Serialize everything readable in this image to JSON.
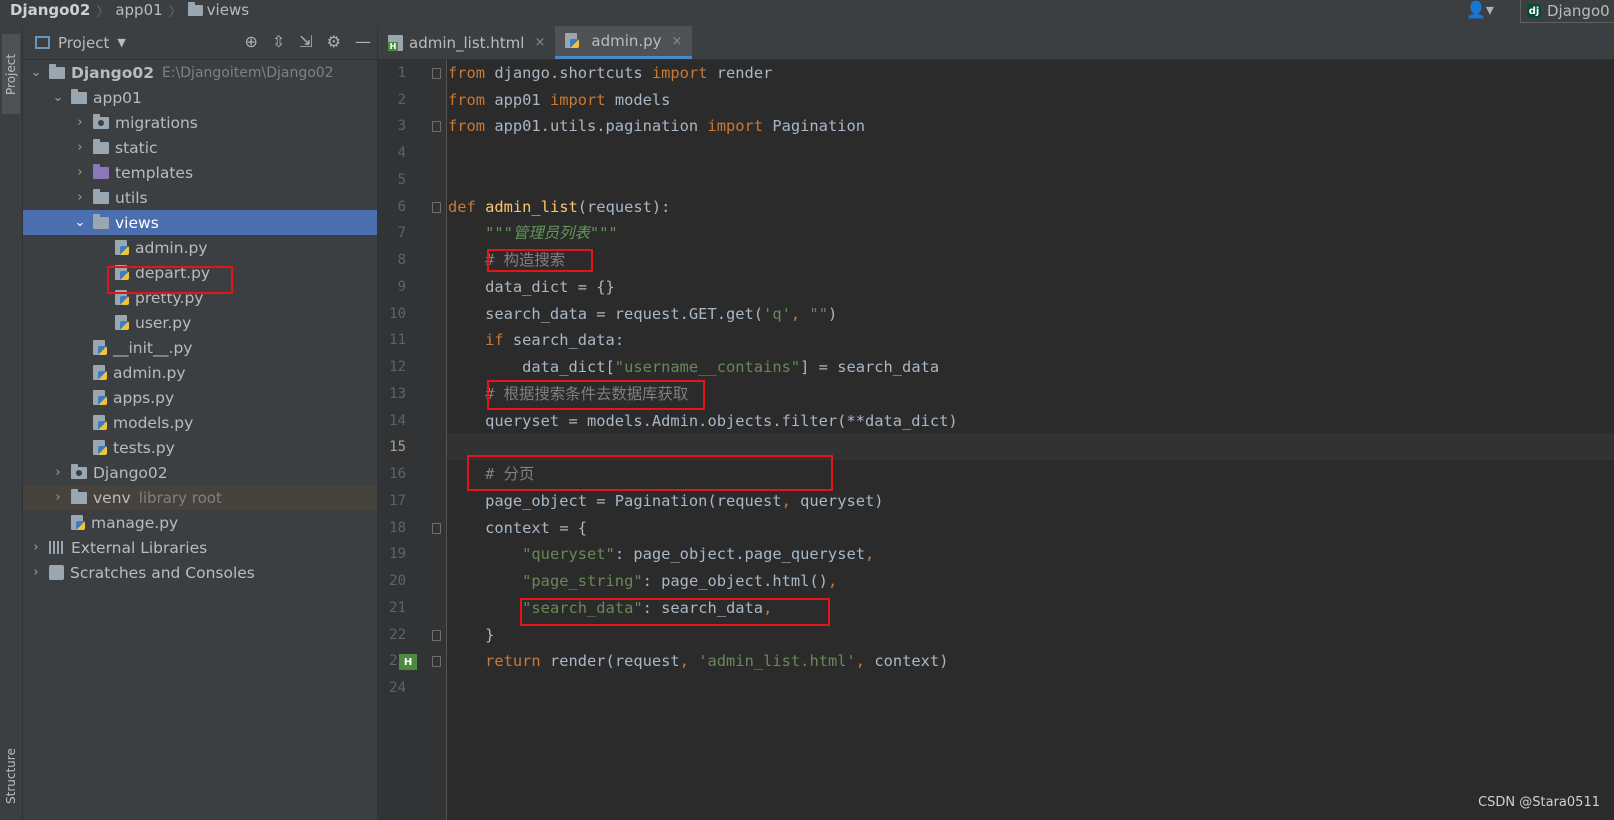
{
  "titlebar": {
    "project": "Django02",
    "crumb_app": "app01",
    "crumb_views": "views",
    "run_config": "Django0"
  },
  "left_strip": {
    "project_tab": "Project",
    "structure_tab": "Structure"
  },
  "project_panel": {
    "title": "Project",
    "tree": [
      {
        "label": "Django02",
        "path": "E:\\Djangoitem\\Django02"
      },
      {
        "label": "app01"
      },
      {
        "label": "migrations"
      },
      {
        "label": "static"
      },
      {
        "label": "templates"
      },
      {
        "label": "utils"
      },
      {
        "label": "views"
      },
      {
        "label": "admin.py"
      },
      {
        "label": "depart.py"
      },
      {
        "label": "pretty.py"
      },
      {
        "label": "user.py"
      },
      {
        "label": "__init__.py"
      },
      {
        "label": "admin.py"
      },
      {
        "label": "apps.py"
      },
      {
        "label": "models.py"
      },
      {
        "label": "tests.py"
      },
      {
        "label": "Django02"
      },
      {
        "label": "venv",
        "note": "library root"
      },
      {
        "label": "manage.py"
      },
      {
        "label": "External Libraries"
      },
      {
        "label": "Scratches and Consoles"
      }
    ]
  },
  "tabs": [
    {
      "label": "admin_list.html",
      "close": "×"
    },
    {
      "label": "admin.py",
      "close": "×"
    }
  ],
  "editor": {
    "line_numbers": [
      "1",
      "2",
      "3",
      "4",
      "5",
      "6",
      "7",
      "8",
      "9",
      "10",
      "11",
      "12",
      "13",
      "14",
      "15",
      "16",
      "17",
      "18",
      "19",
      "20",
      "21",
      "22",
      "23",
      "24"
    ],
    "current_line": 15,
    "gutter_badge": "H"
  },
  "watermark": "CSDN @Stara0511",
  "icons": {
    "user": "user-icon",
    "locate": "crosshair-icon",
    "expand": "expand-all-icon",
    "collapse": "collapse-all-icon",
    "settings": "gear-icon",
    "hide": "minus-icon"
  },
  "colors": {
    "keyword": "#cc7832",
    "function": "#ffc66d",
    "string": "#6a8759",
    "comment": "#808080",
    "selection": "#4b6eaf",
    "highlight_box": "#e5141b"
  }
}
